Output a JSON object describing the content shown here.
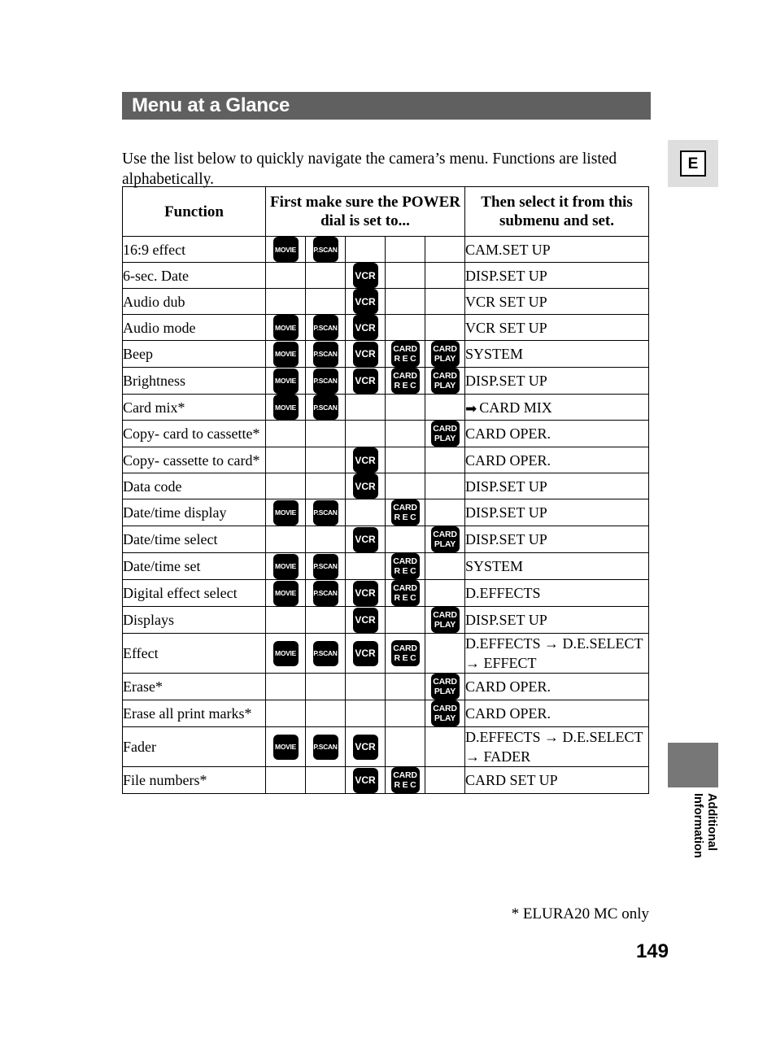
{
  "page": {
    "title": "Menu at a Glance",
    "intro": "Use the list below to quickly navigate the camera’s menu. Functions are listed alphabetically.",
    "footnote": "* ELURA20 MC only",
    "page_number": "149",
    "language_badge": "E",
    "side_tab_label": "Additional\nInformation",
    "title_bar_color": "#606060",
    "side_tab_color": "#777777",
    "badge_box_color": "#dedede"
  },
  "table": {
    "headers": {
      "function": "Function",
      "power_dial": "First make sure the POWER dial is set to...",
      "submenu": "Then select it from this submenu and set."
    },
    "icon_columns": [
      "MOVIE",
      "P.SCAN",
      "VCR",
      "CARD REC",
      "CARD PLAY"
    ],
    "icons": {
      "movie": {
        "lines": [
          "MOVIE"
        ],
        "name": "movie-mode-icon"
      },
      "pscan": {
        "lines": [
          "P.SCAN"
        ],
        "name": "pscan-mode-icon"
      },
      "vcr": {
        "lines": [
          "VCR"
        ],
        "name": "vcr-mode-icon"
      },
      "card_rec": {
        "lines": [
          "CARD",
          "R E C"
        ],
        "name": "card-rec-mode-icon"
      },
      "card_play": {
        "lines": [
          "CARD",
          "PLAY"
        ],
        "name": "card-play-mode-icon"
      }
    },
    "rows": [
      {
        "function": "16:9 effect",
        "modes": [
          1,
          1,
          0,
          0,
          0
        ],
        "submenu": "CAM.SET UP"
      },
      {
        "function": "6-sec. Date",
        "modes": [
          0,
          0,
          1,
          0,
          0
        ],
        "submenu": "DISP.SET UP"
      },
      {
        "function": "Audio dub",
        "modes": [
          0,
          0,
          1,
          0,
          0
        ],
        "submenu": "VCR SET UP"
      },
      {
        "function": "Audio mode",
        "modes": [
          1,
          1,
          1,
          0,
          0
        ],
        "submenu": "VCR SET UP"
      },
      {
        "function": "Beep",
        "modes": [
          1,
          1,
          1,
          1,
          1
        ],
        "submenu": "SYSTEM"
      },
      {
        "function": "Brightness",
        "modes": [
          1,
          1,
          1,
          1,
          1
        ],
        "submenu": "DISP.SET UP"
      },
      {
        "function": "Card mix*",
        "modes": [
          1,
          1,
          0,
          0,
          0
        ],
        "submenu": "CARD MIX",
        "submenu_arrow": "bold"
      },
      {
        "function": "Copy- card to cassette*",
        "modes": [
          0,
          0,
          0,
          0,
          1
        ],
        "submenu": "CARD OPER."
      },
      {
        "function": "Copy- cassette to card*",
        "modes": [
          0,
          0,
          1,
          0,
          0
        ],
        "submenu": "CARD OPER."
      },
      {
        "function": "Data code",
        "modes": [
          0,
          0,
          1,
          0,
          0
        ],
        "submenu": "DISP.SET UP"
      },
      {
        "function": "Date/time display",
        "modes": [
          1,
          1,
          0,
          1,
          0
        ],
        "submenu": "DISP.SET UP"
      },
      {
        "function": "Date/time select",
        "modes": [
          0,
          0,
          1,
          0,
          1
        ],
        "submenu": "DISP.SET UP"
      },
      {
        "function": "Date/time set",
        "modes": [
          1,
          1,
          0,
          1,
          0
        ],
        "submenu": "SYSTEM"
      },
      {
        "function": "Digital effect select",
        "modes": [
          1,
          1,
          1,
          1,
          0
        ],
        "submenu": "D.EFFECTS"
      },
      {
        "function": "Displays",
        "modes": [
          0,
          0,
          1,
          0,
          1
        ],
        "submenu": "DISP.SET UP"
      },
      {
        "function": "Effect",
        "modes": [
          1,
          1,
          1,
          1,
          0
        ],
        "submenu": "D.EFFECTS → D.E.SELECT → EFFECT"
      },
      {
        "function": "Erase*",
        "modes": [
          0,
          0,
          0,
          0,
          1
        ],
        "submenu": "CARD OPER."
      },
      {
        "function": "Erase all print marks*",
        "modes": [
          0,
          0,
          0,
          0,
          1
        ],
        "submenu": "CARD OPER."
      },
      {
        "function": "Fader",
        "modes": [
          1,
          1,
          1,
          0,
          0
        ],
        "submenu": "D.EFFECTS → D.E.SELECT → FADER"
      },
      {
        "function": "File numbers*",
        "modes": [
          0,
          0,
          1,
          1,
          0
        ],
        "submenu": "CARD SET UP"
      }
    ]
  }
}
